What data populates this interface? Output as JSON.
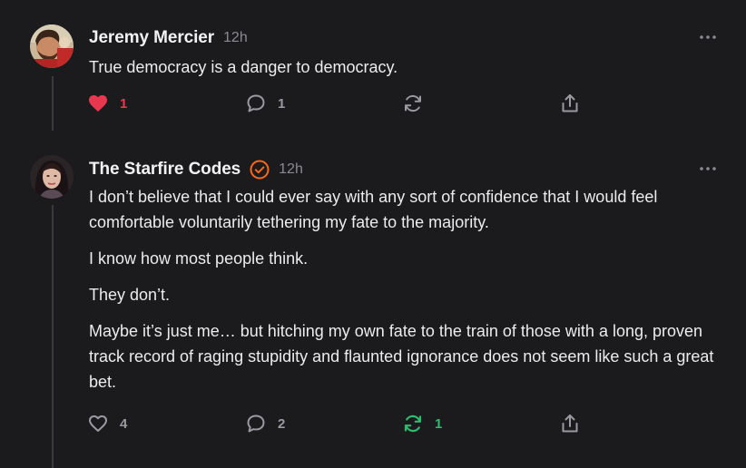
{
  "posts": [
    {
      "author": "Jeremy Mercier",
      "time": "12h",
      "paragraphs": [
        "True democracy is a danger to democracy."
      ],
      "likes": "1",
      "comments": "1",
      "restacks": "",
      "liked": true,
      "restacked": false
    },
    {
      "author": "The Starfire Codes",
      "verified": true,
      "time": "12h",
      "paragraphs": [
        "I don’t believe that I could ever say with any sort of confidence that I would feel comfortable voluntarily tethering my fate to the majority.",
        "I know how most people think.",
        "They don’t.",
        "Maybe it’s just me… but hitching my own fate to the train of those with a long, proven track record of raging stupidity and flaunted ignorance does not seem like such a great bet."
      ],
      "likes": "4",
      "comments": "2",
      "restacks": "1",
      "liked": false,
      "restacked": true
    }
  ],
  "colors": {
    "background": "#1b1b1d",
    "like_active": "#e8384f",
    "restack_active": "#2ebd6e",
    "verified": "#ff6719",
    "icon": "#9a9aa0"
  },
  "icons": [
    "heart-icon",
    "comment-icon",
    "restack-icon",
    "share-icon",
    "more-icon",
    "verified-badge-icon"
  ]
}
